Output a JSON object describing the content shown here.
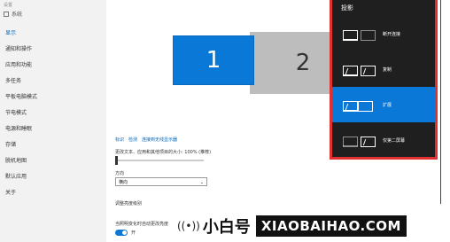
{
  "window": {
    "title": "设置",
    "app_title": "系统"
  },
  "sidebar": {
    "items": [
      {
        "label": "显示",
        "active": true
      },
      {
        "label": "通知和操作",
        "active": false
      },
      {
        "label": "应用和功能",
        "active": false
      },
      {
        "label": "多任务",
        "active": false
      },
      {
        "label": "平板电脑模式",
        "active": false
      },
      {
        "label": "节电模式",
        "active": false
      },
      {
        "label": "电源和睡眠",
        "active": false
      },
      {
        "label": "存储",
        "active": false
      },
      {
        "label": "脱机地图",
        "active": false
      },
      {
        "label": "默认应用",
        "active": false
      },
      {
        "label": "关于",
        "active": false
      }
    ]
  },
  "main": {
    "monitors": [
      {
        "number": "1"
      },
      {
        "number": "2"
      }
    ],
    "links": {
      "identify": "标识",
      "detect": "检测",
      "connect": "连接到无线显示器"
    },
    "scale_label": "更改文本、应用和其他项目的大小: 100% (推荐)",
    "orientation_label": "方向",
    "orientation_value": "横向",
    "brightness_label": "调整亮度级别",
    "auto_brightness_label": "当照明变化时自动更改亮度",
    "auto_brightness_state": "开"
  },
  "project_panel": {
    "title": "投影",
    "options": [
      {
        "label": "断开连接",
        "icon": "pc-screen-only-icon",
        "active": false
      },
      {
        "label": "复制",
        "icon": "duplicate-icon",
        "active": false
      },
      {
        "label": "扩展",
        "icon": "extend-icon",
        "active": true
      },
      {
        "label": "仅第二屏幕",
        "icon": "second-screen-only-icon",
        "active": false
      }
    ]
  },
  "watermark": {
    "brand_cn": "小白号",
    "brand_en": "XIAOBAIHAO.COM"
  },
  "colors": {
    "accent": "#0a78d7",
    "panel_bg": "#1f1f1f",
    "highlight_border": "#e03030"
  }
}
